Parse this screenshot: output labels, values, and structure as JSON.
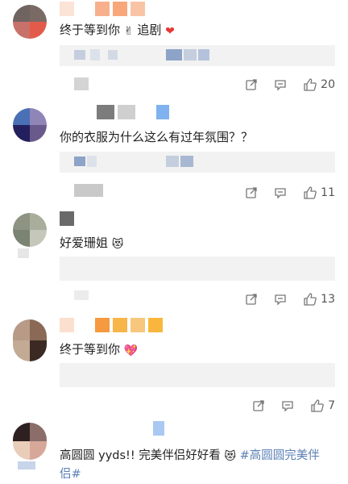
{
  "comments": [
    {
      "text": "终于等到你",
      "emoji_1": "✌",
      "text_2": "追剧",
      "emoji_2": "❤",
      "likes": "20"
    },
    {
      "text": "你的衣服为什么这么有过年氛围？？",
      "likes": "11"
    },
    {
      "text": "好爱珊姐",
      "emoji_1": "😻",
      "likes": "13"
    },
    {
      "text": "终于等到你",
      "emoji_1": "💖",
      "likes": "7"
    },
    {
      "text": "高圆圆 yyds!! 完美伴侣好好看",
      "emoji_1": "😻",
      "hashtag_1": "#高圆圆完美伴",
      "hashtag_2": "侣#"
    }
  ],
  "icons": {
    "share": "share-icon",
    "comment": "comment-icon",
    "like": "thumb-up-icon"
  }
}
